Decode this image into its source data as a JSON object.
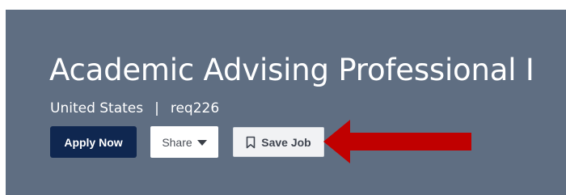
{
  "job": {
    "title": "Academic Advising Professional I",
    "location": "United States",
    "separator": "|",
    "req_id": "req226"
  },
  "actions": {
    "apply_label": "Apply Now",
    "share_label": "Share",
    "save_label": "Save Job"
  },
  "icons": {
    "share_dropdown": "caret-down-icon",
    "save": "bookmark-icon",
    "annotation": "red-arrow-left"
  },
  "colors": {
    "banner": "#5f6e82",
    "apply_button": "#0f2750",
    "annotation_arrow": "#c00000"
  }
}
